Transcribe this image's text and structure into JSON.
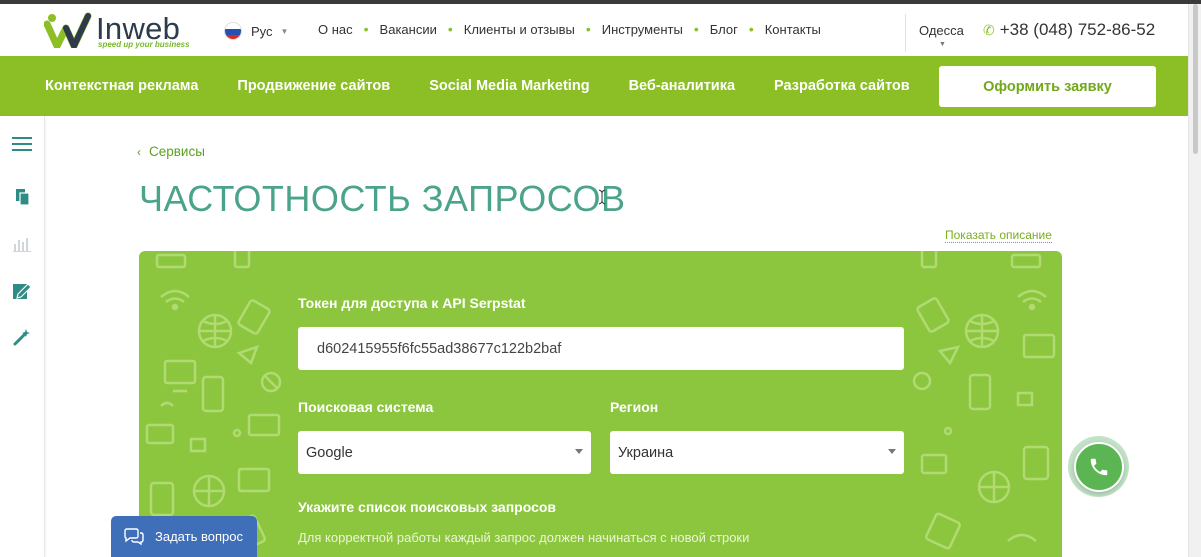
{
  "brand": {
    "name": "Inweb",
    "tagline": "speed up your business",
    "accent_color": "#8cbf26",
    "title_color": "#4aa38a"
  },
  "header": {
    "language": "Рус",
    "language_flag": "russia-flag-icon",
    "nav": [
      "О нас",
      "Вакансии",
      "Клиенты и отзывы",
      "Инструменты",
      "Блог",
      "Контакты"
    ],
    "city": "Одесса",
    "phone": "+38 (048) 752-86-52"
  },
  "main_nav": {
    "items": [
      "Контекстная реклама",
      "Продвижение сайтов",
      "Social Media Marketing",
      "Веб-аналитика",
      "Разработка сайтов"
    ],
    "cta": "Оформить заявку"
  },
  "sidebar": {
    "icons": [
      "menu-icon",
      "copy-icon",
      "chart-icon",
      "edit-icon",
      "magic-wand-icon"
    ]
  },
  "page": {
    "breadcrumb": "Сервисы",
    "title": "ЧАСТОТНОСТЬ ЗАПРОСОВ",
    "show_description": "Показать описание"
  },
  "form": {
    "token_label": "Токен для доступа к API Serpstat",
    "token_value": "d602415955f6fc55ad38677c122b2baf",
    "engine_label": "Поисковая система",
    "engine_value": "Google",
    "region_label": "Регион",
    "region_value": "Украина",
    "queries_label": "Укажите список поисковых запросов",
    "queries_hint": "Для корректной работы каждый запрос должен начинаться с новой строки"
  },
  "widgets": {
    "chat_label": "Задать вопрос",
    "call_icon": "phone-icon"
  }
}
